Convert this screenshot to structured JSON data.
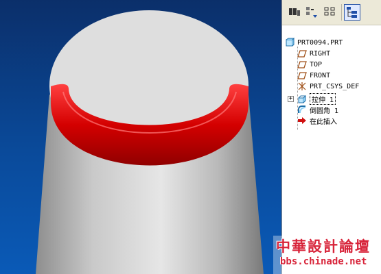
{
  "viewport": {
    "background_top": "#0b2f6a",
    "background_bottom": "#0a5ab7",
    "model_color": "#dcdcdc",
    "round_color": "#e01010"
  },
  "toolbar": {
    "buttons": [
      {
        "name": "show-icon"
      },
      {
        "name": "settings-icon"
      },
      {
        "name": "columns-icon"
      },
      {
        "name": "model-tree-icon",
        "active": true
      }
    ]
  },
  "tree": {
    "root": "PRT0094.PRT",
    "items": [
      {
        "label": "RIGHT",
        "icon": "datum-plane-icon"
      },
      {
        "label": "TOP",
        "icon": "datum-plane-icon"
      },
      {
        "label": "FRONT",
        "icon": "datum-plane-icon"
      },
      {
        "label": "PRT_CSYS_DEF",
        "icon": "csys-icon"
      },
      {
        "label": "拉伸 1",
        "icon": "extrude-icon",
        "expandable": true,
        "selected": true
      },
      {
        "label": "倒圆角 1",
        "icon": "round-icon"
      },
      {
        "label": "在此插入",
        "icon": "insert-arrow-icon"
      }
    ]
  },
  "watermark": {
    "title": "中華設計論壇",
    "url": "bbs.chinade.net"
  }
}
